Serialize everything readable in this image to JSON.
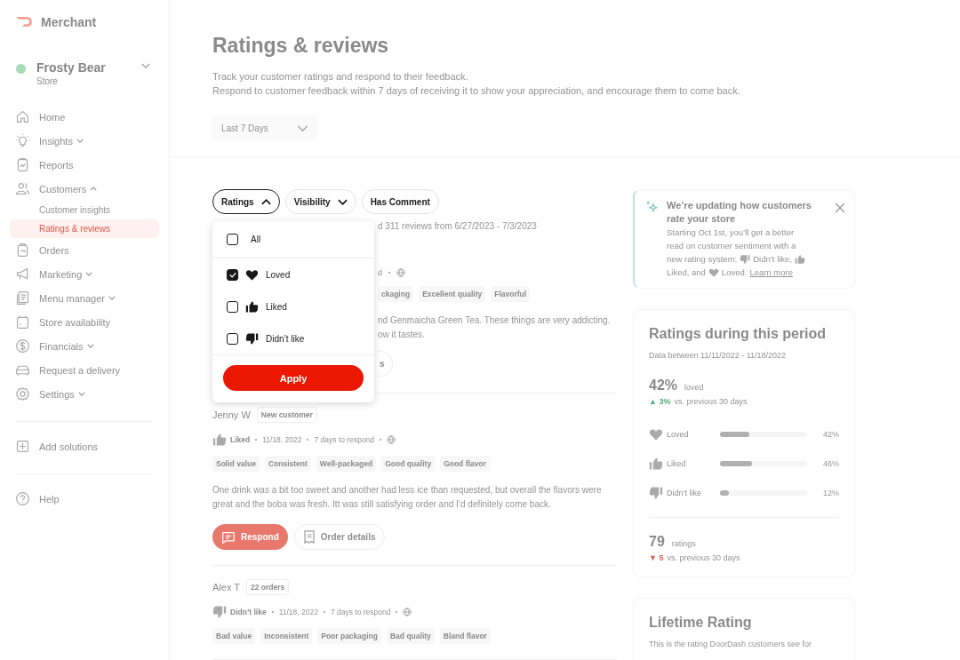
{
  "sidebar": {
    "brand": "Merchant",
    "store": {
      "name": "Frosty Bear",
      "subtitle": "Store",
      "color": "#a8dbb8"
    },
    "items": [
      {
        "label": "Home",
        "selected": false
      },
      {
        "label": "Insights",
        "selected": false,
        "expanded": false
      },
      {
        "label": "Reports",
        "selected": false
      },
      {
        "label": "Customers",
        "selected": false,
        "expanded": true,
        "children": [
          {
            "label": "Customer insights",
            "selected": false
          },
          {
            "label": "Ratings & reviews",
            "selected": true
          }
        ]
      },
      {
        "label": "Orders",
        "selected": false
      },
      {
        "label": "Marketing",
        "selected": false,
        "expanded": false
      },
      {
        "label": "Menu manager",
        "selected": false,
        "expanded": false
      },
      {
        "label": "Store availability",
        "selected": false
      },
      {
        "label": "Financials",
        "selected": false,
        "expanded": false
      },
      {
        "label": "Request a delivery",
        "selected": false
      },
      {
        "label": "Settings",
        "selected": false,
        "expanded": false
      }
    ],
    "extra_items": [
      {
        "label": "Add solutions"
      },
      {
        "label": "Help"
      }
    ]
  },
  "header": {
    "title": "Ratings & reviews",
    "subtitle": [
      "Track your customer ratings and respond to their feedback.",
      "Respond to customer feedback within 7 days of receiving it to show your appreciation, and encourage them to come back."
    ],
    "period": "Last 7 Days"
  },
  "filters": [
    {
      "label": "Ratings",
      "kind": "menu",
      "expanded": true
    },
    {
      "label": "Visibility",
      "kind": "menu",
      "expanded": false
    },
    {
      "label": "Has Comment",
      "kind": "toggle"
    }
  ],
  "ratings_menu": {
    "options": [
      {
        "label": "All",
        "kind": "all",
        "checked": false
      },
      {
        "label": "Loved",
        "kind": "loved",
        "checked": true
      },
      {
        "label": "Liked",
        "kind": "liked",
        "checked": false
      },
      {
        "label": "Didn’t like",
        "kind": "disliked",
        "checked": false
      }
    ],
    "apply": "Apply"
  },
  "summary": "d 311 reviews from 6/27/2023 - 7/3/2023",
  "partial_review": {
    "meta": "d",
    "tags": [
      "ckaging",
      "Excellent quality",
      "Flavorful"
    ],
    "text": [
      "nd Genmaicha Green Tea. These things are very addicting.",
      "ow it tastes."
    ],
    "button": "s"
  },
  "reviews": [
    {
      "name": "Jenny W",
      "badge": "New customer",
      "kind": "liked",
      "rating_label": "Liked",
      "date": "11/18, 2022",
      "respond": "7 days to respond",
      "tags": [
        "Solid value",
        "Consistent",
        "Well-packaged",
        "Good quality",
        "Good flavor"
      ],
      "text": "One drink was a bit too sweet and another had less ice than requested, but overall the flavors were great and the boba was fresh. Itt was still satisfying order and I’d definitely come back.",
      "buttons": [
        "Respond",
        "Order details"
      ]
    },
    {
      "name": "Alex T",
      "badge": "22 orders",
      "kind": "disliked",
      "rating_label": "Didn’t like",
      "date": "11/18, 2022",
      "respond": "7 days to respond",
      "tags": [
        "Bad value",
        "Inconsistent",
        "Poor packaging",
        "Bad quality",
        "Bland flavor"
      ]
    }
  ],
  "notice": {
    "title": "We’re updating how customers rate your store",
    "body": [
      {
        "kind": "text",
        "text": "Starting Oct 1st, you’ll get a better"
      },
      {
        "kind": "text",
        "text": "read on customer sentiment with a"
      },
      {
        "kind": "text",
        "text": "new rating system:"
      },
      {
        "kind": "disliked"
      },
      {
        "kind": "text",
        "text": "Didn’t like,"
      },
      {
        "kind": "liked"
      },
      {
        "kind": "text",
        "text": "Liked, and"
      },
      {
        "kind": "loved"
      },
      {
        "kind": "text",
        "text": "Loved."
      },
      {
        "kind": "link",
        "text": "Learn more"
      }
    ]
  },
  "period_card": {
    "title": "Ratings during this period",
    "subtitle": "Data between 11/11/2022 - 11/18/2022",
    "headline": {
      "value": "42%",
      "label": "loved",
      "trend": {
        "kind": "up",
        "arrow": "▲",
        "value": "3%",
        "text": "vs. previous 30 days"
      }
    },
    "bars": [
      {
        "kind": "loved",
        "label": "Loved",
        "level": 0.34,
        "reading": "42%"
      },
      {
        "kind": "liked",
        "label": "Liked",
        "level": 0.37,
        "reading": "46%"
      },
      {
        "kind": "disliked",
        "label": "Didn’t like",
        "level": 0.1,
        "reading": "12%"
      }
    ],
    "total": {
      "value": "79",
      "label": "ratings",
      "trend": {
        "kind": "down",
        "arrow": "▼",
        "value": "5",
        "text": "vs. previous 30 days"
      }
    }
  },
  "lifetime_card": {
    "title": "Lifetime Rating",
    "subtitle": "This is the rating DoorDash customers see for"
  }
}
